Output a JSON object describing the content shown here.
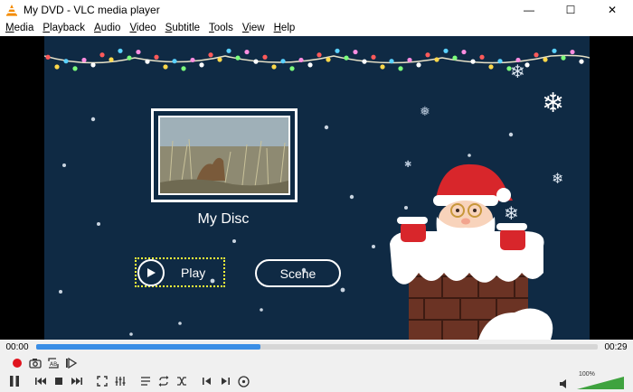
{
  "window": {
    "title": "My DVD - VLC media player",
    "minimize": "—",
    "maximize": "☐",
    "close": "✕"
  },
  "menu": [
    {
      "label": "Media",
      "key": "M",
      "rest": "edia"
    },
    {
      "label": "Playback",
      "key": "P",
      "rest": "layback"
    },
    {
      "label": "Audio",
      "key": "A",
      "rest": "udio"
    },
    {
      "label": "Video",
      "key": "V",
      "rest": "ideo"
    },
    {
      "label": "Subtitle",
      "key": "S",
      "rest": "ubtitle"
    },
    {
      "label": "Tools",
      "key": "T",
      "rest": "ools"
    },
    {
      "label": "View",
      "key": "V",
      "rest": "iew"
    },
    {
      "label": "Help",
      "key": "H",
      "rest": "elp"
    }
  ],
  "dvd_menu": {
    "disc_title": "My Disc",
    "play_label": "Play",
    "scene_label": "Scene"
  },
  "playback": {
    "elapsed": "00:00",
    "total": "00:29",
    "progress": 0.4
  },
  "volume": {
    "label": "100%",
    "level": 1.0
  },
  "colors": {
    "background": "#0f2a44",
    "focus": "#ffff3a",
    "seek_fill": "#3a8ee6",
    "record": "#e0141e"
  }
}
